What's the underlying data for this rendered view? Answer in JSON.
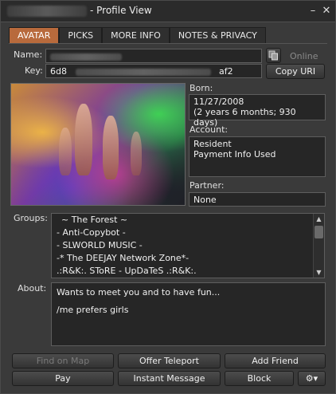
{
  "window": {
    "title": "- Profile View",
    "minimize_glyph": "–",
    "close_glyph": "✕"
  },
  "tabs": [
    "AVATAR",
    "PICKS",
    "MORE INFO",
    "NOTES & PRIVACY"
  ],
  "profile": {
    "name_label": "Name:",
    "key_label": "Key:",
    "key_start": "6d8",
    "key_end": "af2",
    "online_status": "Online",
    "copy_uri": "Copy URI",
    "born_label": "Born:",
    "born_date": "11/27/2008",
    "born_age": "(2 years 6 months; 930 days)",
    "account_label": "Account:",
    "account_type": "Resident",
    "payment_info": "Payment Info Used",
    "partner_label": "Partner:",
    "partner_value": "None",
    "groups_label": "Groups:",
    "groups": [
      "~ The Forest ~",
      "- Anti-Copybot -",
      "- SLWORLD MUSIC -",
      "-* The DEEJAY Network Zone*-",
      ".:R&K:. SToRE - UpDaTeS .:R&K:."
    ],
    "about_label": "About:",
    "about_line1": "Wants to meet you and to have fun...",
    "about_line2": "/me prefers girls"
  },
  "buttons": {
    "find_on_map": "Find on Map",
    "offer_teleport": "Offer Teleport",
    "add_friend": "Add Friend",
    "pay": "Pay",
    "instant_message": "Instant Message",
    "block": "Block",
    "gear": "⚙▾"
  },
  "icons": {
    "profile_options": "copy-icon",
    "settings": "gear-icon"
  }
}
